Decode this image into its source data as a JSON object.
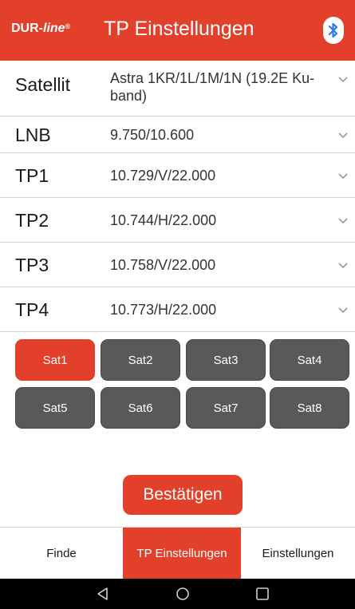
{
  "header": {
    "brand_main": "DUR-",
    "brand_italic": "line",
    "brand_mark": "®",
    "title": "TP Einstellungen",
    "bluetooth_icon": "bluetooth-icon",
    "color": "#e2402b"
  },
  "rows": [
    {
      "label": "Satellit",
      "value": "Astra 1KR/1L/1M/1N (19.2E Ku-band)"
    },
    {
      "label": "LNB",
      "value": "9.750/10.600"
    },
    {
      "label": "TP1",
      "value": "10.729/V/22.000"
    },
    {
      "label": "TP2",
      "value": "10.744/H/22.000"
    },
    {
      "label": "TP3",
      "value": "10.758/V/22.000"
    },
    {
      "label": "TP4",
      "value": "10.773/H/22.000"
    }
  ],
  "sat_buttons": [
    "Sat1",
    "Sat2",
    "Sat3",
    "Sat4",
    "Sat5",
    "Sat6",
    "Sat7",
    "Sat8"
  ],
  "sat_active": "Sat1",
  "confirm_label": "Bestätigen",
  "tabs": [
    {
      "label": "Finde"
    },
    {
      "label": "TP Einstellungen"
    },
    {
      "label": "Einstellungen"
    }
  ],
  "active_tab": "TP Einstellungen",
  "colors": {
    "accent": "#e2402b",
    "button_gray": "#595959"
  }
}
